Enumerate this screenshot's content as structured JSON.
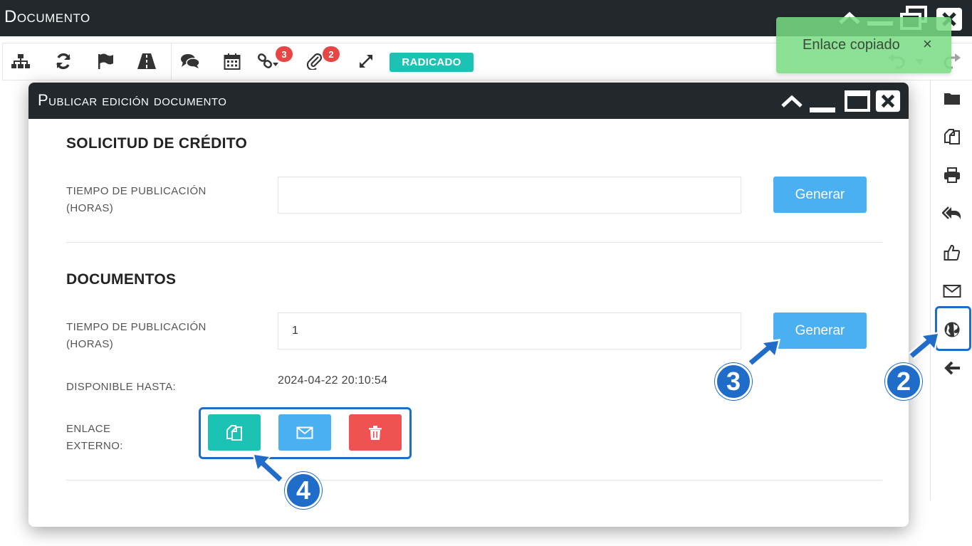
{
  "window": {
    "title": "Documento"
  },
  "toolbar": {
    "badges": {
      "links": "3",
      "attachments": "2"
    },
    "status_label": "RADICADO"
  },
  "toast": {
    "message": "Enlace copiado",
    "close_label": "×"
  },
  "modal": {
    "title": "Publicar edición documento",
    "section1": {
      "title": "SOLICITUD DE CRÉDITO",
      "time_label_line1": "TIEMPO DE PUBLICACIÓN",
      "time_label_line2": "(HORAS)",
      "time_value": "",
      "generate_label": "Generar"
    },
    "section2": {
      "title": "DOCUMENTOS",
      "time_label_line1": "TIEMPO DE PUBLICACIÓN",
      "time_label_line2": "(HORAS)",
      "time_value": "1",
      "generate_label": "Generar",
      "available_label": "DISPONIBLE HASTA:",
      "available_value": "2024-04-22 20:10:54",
      "link_label_line1": "ENLACE",
      "link_label_line2": "EXTERNO:"
    }
  },
  "annotations": {
    "step2": "2",
    "step3": "3",
    "step4": "4"
  },
  "colors": {
    "dark_bar": "#22282c",
    "accent_blue": "#4ab0f2",
    "teal": "#1cc3b4",
    "danger": "#f05252",
    "badge_red": "#e84545",
    "annotation_blue": "#1f6cc9",
    "toast_green": "#78dc82"
  }
}
